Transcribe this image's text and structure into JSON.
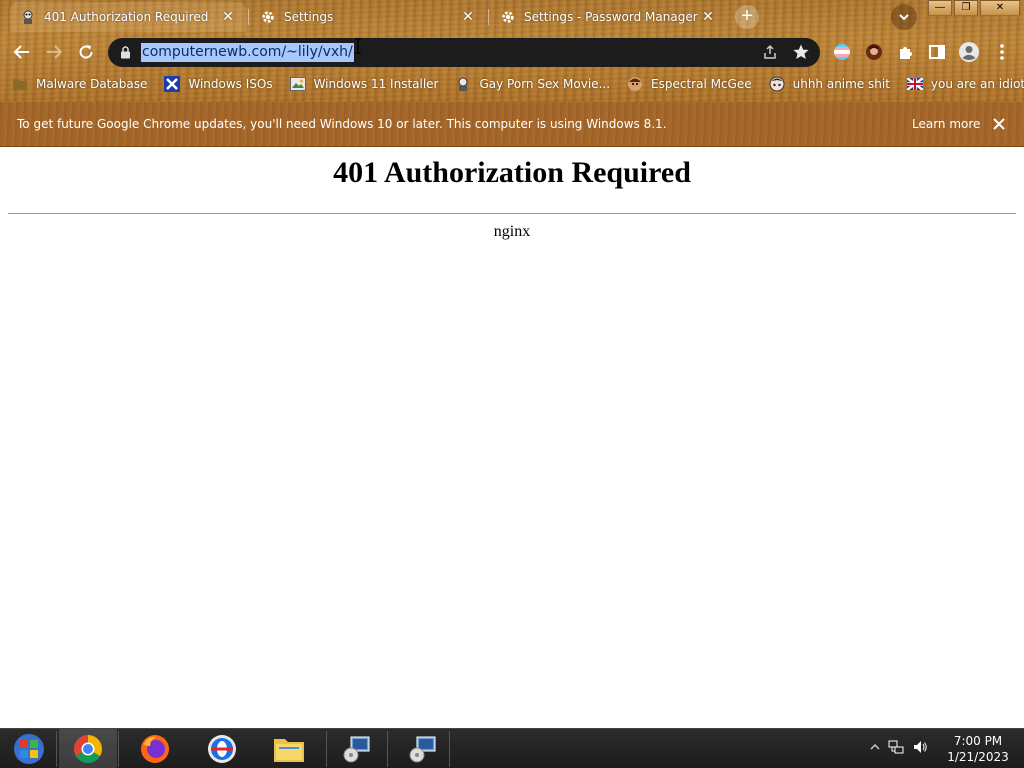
{
  "tabs": [
    {
      "title": "401 Authorization Required",
      "icon": "site-icon",
      "active": true
    },
    {
      "title": "Settings",
      "icon": "gear-icon",
      "active": false
    },
    {
      "title": "Settings - Password Manager",
      "icon": "gear-icon",
      "active": false
    }
  ],
  "window_controls": {
    "minimize": "—",
    "restore": "❐",
    "close": "✕"
  },
  "omnibox": {
    "url": "computernewb.com/~lily/vxh/"
  },
  "bookmarks": [
    {
      "label": "Malware Database",
      "icon": "folder-icon"
    },
    {
      "label": "Windows ISOs",
      "icon": "x-icon"
    },
    {
      "label": "Windows 11 Installer",
      "icon": "image-icon"
    },
    {
      "label": "Gay Porn Sex Movie...",
      "icon": "site-icon"
    },
    {
      "label": "Espectral McGee",
      "icon": "face-icon"
    },
    {
      "label": "uhhh anime shit",
      "icon": "anime-icon"
    },
    {
      "label": "you are an idiot!",
      "icon": "flag-icon"
    }
  ],
  "infobar": {
    "message": "To get future Google Chrome updates, you'll need Windows 10 or later. This computer is using Windows 8.1.",
    "link": "Learn more"
  },
  "page": {
    "heading": "401 Authorization Required",
    "server": "nginx"
  },
  "taskbar": {
    "apps": [
      "start-button",
      "chrome",
      "firefox",
      "opera",
      "file-explorer",
      "installer",
      "installer"
    ],
    "time": "7:00 PM",
    "date": "1/21/2023"
  }
}
